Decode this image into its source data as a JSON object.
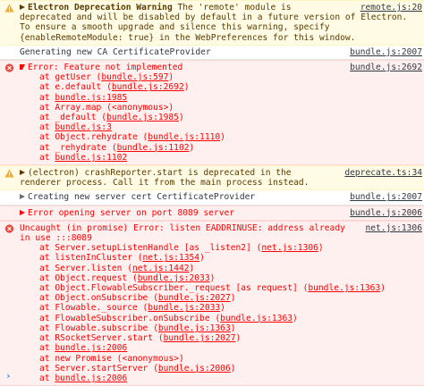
{
  "messages": [
    {
      "level": "warning",
      "source": "remote.js:20",
      "bold_title": "Electron Deprecation Warning",
      "lines": [
        " The 'remote' module is",
        "deprecated and will be disabled by default in a future version of Electron.",
        "To ensure a smooth upgrade and silence this warning, specify",
        "{enableRemoteModule: true} in the WebPreferences for this window."
      ]
    },
    {
      "level": "info",
      "source": "bundle.js:2007",
      "text": "Generating new CA CertificateProvider"
    },
    {
      "level": "error",
      "source": "bundle.js:2692",
      "text": "Error: Feature not implemented",
      "trace": [
        {
          "pre": "at getUser (",
          "ref": "bundle.js:597",
          "post": ")"
        },
        {
          "pre": "at e.default (",
          "ref": "bundle.js:2692",
          "post": ")"
        },
        {
          "pre": "at ",
          "ref": "bundle.js:1985",
          "post": ""
        },
        {
          "pre": "at Array.map (<anonymous>)",
          "ref": "",
          "post": ""
        },
        {
          "pre": "at _default (",
          "ref": "bundle.js:1985",
          "post": ")"
        },
        {
          "pre": "at ",
          "ref": "bundle.js:3",
          "post": ""
        },
        {
          "pre": "at Object.rehydrate (",
          "ref": "bundle.js:1110",
          "post": ")"
        },
        {
          "pre": "at _rehydrate (",
          "ref": "bundle.js:1102",
          "post": ")"
        },
        {
          "pre": "at ",
          "ref": "bundle.js:1102",
          "post": ""
        }
      ]
    },
    {
      "level": "warning",
      "source": "deprecate.ts:34",
      "lines": [
        "(electron) crashReporter.start is deprecated in the",
        "renderer process. Call it from the main process instead."
      ]
    },
    {
      "level": "info",
      "source": "bundle.js:2007",
      "text": "Creating new server cert CertificateProvider"
    },
    {
      "level": "error",
      "source": "bundle.js:2006",
      "text": "Error opening server on port 8089 server"
    },
    {
      "level": "error",
      "source": "net.js:1306",
      "lines": [
        "Uncaught (in promise) Error: listen EADDRINUSE: address already",
        "in use :::8089"
      ],
      "trace": [
        {
          "pre": "at Server.setupListenHandle [as _listen2] (",
          "ref": "net.js:1306",
          "post": ")"
        },
        {
          "pre": "at listenInCluster (",
          "ref": "net.js:1354",
          "post": ")"
        },
        {
          "pre": "at Server.listen (",
          "ref": "net.js:1442",
          "post": ")"
        },
        {
          "pre": "at Object.request (",
          "ref": "bundle.js:2033",
          "post": ")"
        },
        {
          "pre": "at Object.FlowableSubscriber._request [as request] (",
          "ref": "bundle.js:1363",
          "post": ")"
        },
        {
          "pre": "at Object.onSubscribe (",
          "ref": "bundle.js:2027",
          "post": ")"
        },
        {
          "pre": "at Flowable._source (",
          "ref": "bundle.js:2033",
          "post": ")"
        },
        {
          "pre": "at FlowableSubscriber.onSubscribe (",
          "ref": "bundle.js:1363",
          "post": ")"
        },
        {
          "pre": "at Flowable.subscribe (",
          "ref": "bundle.js:1363",
          "post": ")"
        },
        {
          "pre": "at RSocketServer.start (",
          "ref": "bundle.js:2027",
          "post": ")"
        },
        {
          "pre": "at ",
          "ref": "bundle.js:2006",
          "post": ""
        },
        {
          "pre": "at new Promise (<anonymous>)",
          "ref": "",
          "post": ""
        },
        {
          "pre": "at Server.startServer (",
          "ref": "bundle.js:2006",
          "post": ")"
        },
        {
          "pre": "at ",
          "ref": "bundle.js:2006",
          "post": ""
        }
      ]
    }
  ],
  "prompt_caret": "›",
  "colors": {
    "error": "#fe0000",
    "warning_bg": "#fffbe5",
    "error_bg": "#fff0f0"
  }
}
